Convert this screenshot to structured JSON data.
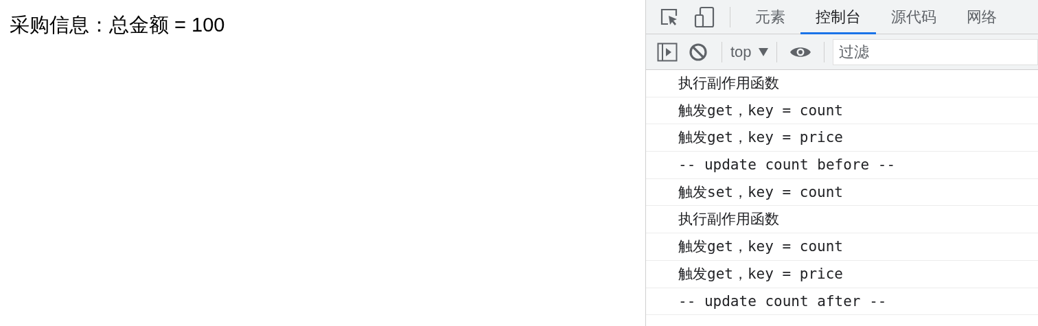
{
  "page": {
    "text": "采购信息：总金额 = 100"
  },
  "devtools": {
    "tabs": [
      {
        "label": "元素",
        "selected": false
      },
      {
        "label": "控制台",
        "selected": true
      },
      {
        "label": "源代码",
        "selected": false
      },
      {
        "label": "网络",
        "selected": false
      }
    ],
    "toolbar": {
      "context": "top",
      "filter": {
        "placeholder": "过滤"
      }
    },
    "console": [
      "执行副作用函数",
      "触发get，key = count",
      "触发get，key = price",
      "-- update count before --",
      "触发set，key = count",
      "执行副作用函数",
      "触发get，key = count",
      "触发get，key = price",
      "-- update count after --"
    ]
  }
}
